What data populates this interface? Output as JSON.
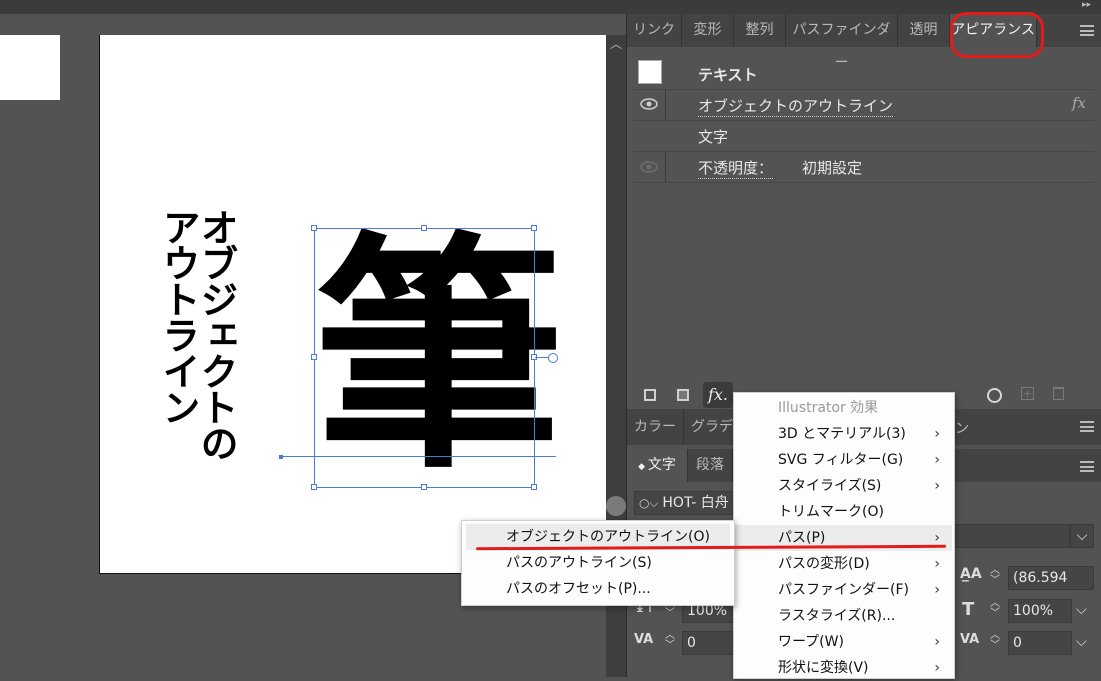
{
  "canvas": {
    "vertical_text_col1": "オブジェクトの",
    "vertical_text_col2": "アウトライン",
    "glyph": "筆"
  },
  "tabs": [
    "リンク",
    "変形",
    "整列",
    "パスファインダー",
    "透明",
    "アピアランス"
  ],
  "appearance": {
    "header": "テキスト",
    "effect_label": "オブジェクトのアウトライン",
    "fx_glyph": "fx",
    "character_label": "文字",
    "opacity_label": "不透明度：",
    "opacity_value": "初期設定",
    "fx_button": "fx."
  },
  "lower_tabs": [
    "カラー",
    "グラデ"
  ],
  "char_panel": {
    "tabs": [
      "文字",
      "段落"
    ],
    "font_name": "HOT- 白舟",
    "size_value": "(86.594",
    "leading_value": "100%",
    "scale_value": "100%",
    "tracking_value": "0",
    "kerning_value": "0"
  },
  "effects_menu": {
    "header": "Illustrator 効果",
    "items": [
      {
        "label": "3D とマテリアル(3)",
        "submenu": true
      },
      {
        "label": "SVG フィルター(G)",
        "submenu": true
      },
      {
        "label": "スタイライズ(S)",
        "submenu": true
      },
      {
        "label": "トリムマーク(O)",
        "submenu": false
      },
      {
        "label": "パス(P)",
        "submenu": true
      },
      {
        "label": "パスの変形(D)",
        "submenu": true
      },
      {
        "label": "パスファインダー(F)",
        "submenu": true
      },
      {
        "label": "ラスタライズ(R)...",
        "submenu": false
      },
      {
        "label": "ワープ(W)",
        "submenu": true
      },
      {
        "label": "形状に変換(V)",
        "submenu": true
      }
    ]
  },
  "path_submenu": {
    "items": [
      "オブジェクトのアウトライン(O)",
      "パスのアウトライン(S)",
      "パスのオフセット(P)..."
    ]
  },
  "colors": {
    "annotation": "#e21b1b",
    "selection": "#4a7bd8"
  }
}
